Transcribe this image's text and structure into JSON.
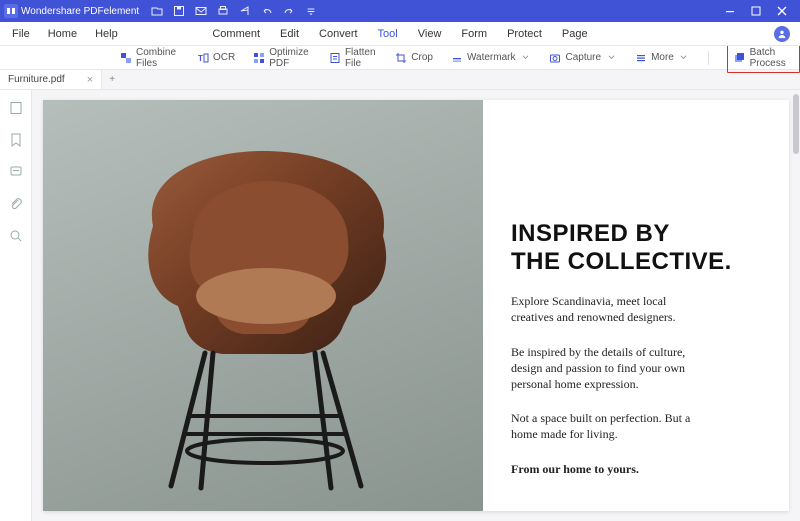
{
  "app": {
    "title": "Wondershare PDFelement"
  },
  "menu": {
    "left": [
      "File",
      "Home",
      "Help"
    ],
    "center": [
      "Comment",
      "Edit",
      "Convert",
      "Tool",
      "View",
      "Form",
      "Protect",
      "Page"
    ],
    "active": "Tool"
  },
  "toolbar": {
    "combine": "Combine Files",
    "ocr": "OCR",
    "optimize": "Optimize PDF",
    "flatten": "Flatten File",
    "crop": "Crop",
    "watermark": "Watermark",
    "capture": "Capture",
    "more": "More",
    "batch": "Batch Process"
  },
  "tab": {
    "name": "Furniture.pdf"
  },
  "doc": {
    "h1a": "INSPIRED BY",
    "h1b": "THE COLLECTIVE.",
    "p1": "Explore Scandinavia, meet local creatives and renowned designers.",
    "p2": "Be inspired by the details of culture, design and passion to find your own personal home expression.",
    "p3": "Not a space built on perfection. But a home made for living.",
    "p4": "From our home to yours."
  }
}
